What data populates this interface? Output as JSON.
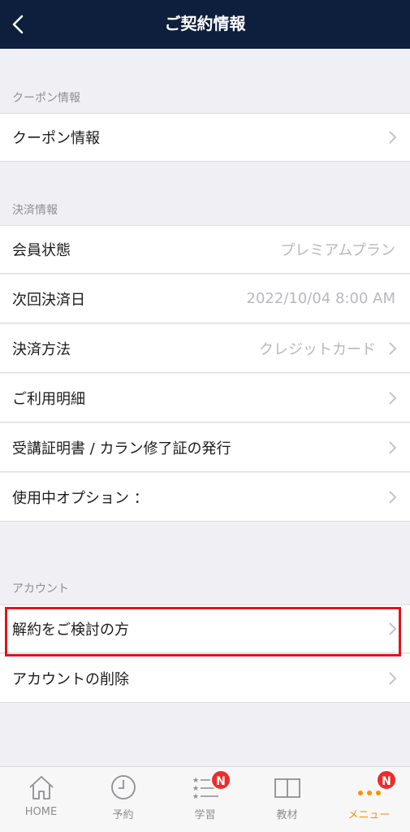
{
  "header": {
    "title": "ご契約情報"
  },
  "sections": {
    "coupon": {
      "header": "クーポン情報",
      "rows": [
        {
          "label": "クーポン情報"
        }
      ]
    },
    "payment": {
      "header": "決済情報",
      "rows": [
        {
          "label": "会員状態",
          "value": "プレミアムプラン"
        },
        {
          "label": "次回決済日",
          "value": "2022/10/04 8:00 AM"
        },
        {
          "label": "決済方法",
          "value": "クレジットカード"
        },
        {
          "label": "ご利用明細"
        },
        {
          "label": "受講証明書 / カラン修了証の発行"
        },
        {
          "label": "使用中オプション ："
        }
      ]
    },
    "account": {
      "header": "アカウント",
      "rows": [
        {
          "label": "解約をご検討の方"
        },
        {
          "label": "アカウントの削除"
        }
      ]
    }
  },
  "tabbar": {
    "tabs": [
      {
        "label": "HOME",
        "icon": "home-icon"
      },
      {
        "label": "予約",
        "icon": "clock-icon"
      },
      {
        "label": "学習",
        "icon": "list-icon",
        "badge": "N"
      },
      {
        "label": "教材",
        "icon": "book-icon"
      },
      {
        "label": "メニュー",
        "icon": "more-icon",
        "badge": "N",
        "active": true
      }
    ]
  },
  "colors": {
    "navbar": "#0d1f3c",
    "active_tab": "#ff8f00",
    "badge": "#ee2b2b",
    "highlight": "#e0141d"
  }
}
